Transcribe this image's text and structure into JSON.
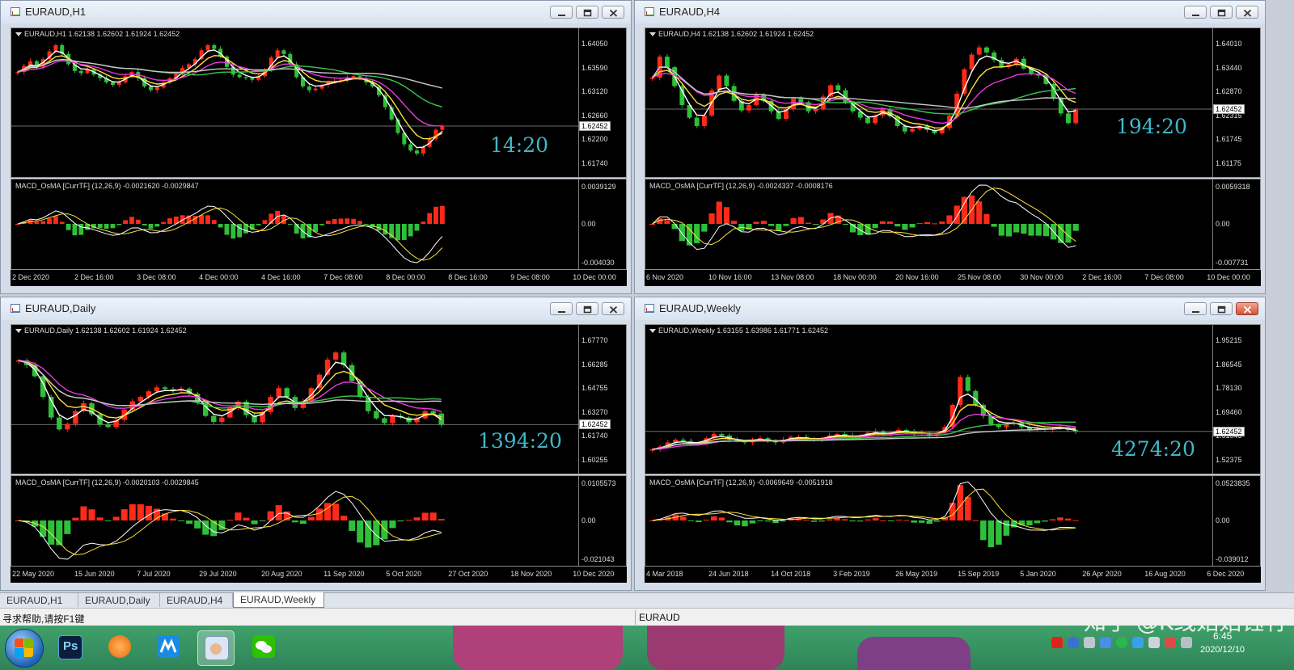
{
  "theme": {
    "bull": "#ff2a1a",
    "bear": "#2fc03a",
    "ma_white": "#ffffff",
    "ma_yellow": "#ffe23a",
    "ma_magenta": "#e53ae0",
    "ma_green": "#39c94a",
    "ma_gray": "#c8c8c8",
    "counter_color": "#3fb8c8"
  },
  "windows": [
    {
      "id": "h1",
      "title": "EURAUD,H1",
      "close_highlight": false,
      "legend": "EURAUD,H1  1.62138 1.62602 1.61924 1.62452",
      "price_ticks": [
        "1.64050",
        "1.63590",
        "1.63120",
        "1.62660",
        "1.62200",
        "1.61740"
      ],
      "current_price": "1.62452",
      "countdown": "14:20",
      "macd_legend": "MACD_OsMA [CurrTF] (12,26,9) -0.0021620 -0.0029847",
      "macd_ticks": [
        "0.0039129",
        "0.00",
        "-0.004030"
      ],
      "time_labels": [
        "2 Dec 2020",
        "2 Dec 16:00",
        "3 Dec 08:00",
        "4 Dec 00:00",
        "4 Dec 16:00",
        "7 Dec 08:00",
        "8 Dec 00:00",
        "8 Dec 16:00",
        "9 Dec 08:00",
        "10 Dec 00:00"
      ],
      "chart_data": {
        "type": "candlestick",
        "close": [
          1.635,
          1.6362,
          1.6371,
          1.636,
          1.6375,
          1.639,
          1.6402,
          1.6385,
          1.6365,
          1.6352,
          1.6348,
          1.6355,
          1.6345,
          1.6338,
          1.633,
          1.6325,
          1.633,
          1.6342,
          1.635,
          1.6338,
          1.6322,
          1.6315,
          1.632,
          1.633,
          1.6338,
          1.6346,
          1.6358,
          1.6365,
          1.6375,
          1.6392,
          1.6402,
          1.6395,
          1.638,
          1.636,
          1.6345,
          1.634,
          1.6338,
          1.6335,
          1.6342,
          1.6355,
          1.6378,
          1.6392,
          1.6385,
          1.6365,
          1.634,
          1.6322,
          1.6315,
          1.6318,
          1.6325,
          1.633,
          1.6332,
          1.6335,
          1.634,
          1.6342,
          1.6338,
          1.633,
          1.6322,
          1.6305,
          1.6282,
          1.6258,
          1.6232,
          1.621,
          1.6198,
          1.6192,
          1.6205,
          1.622,
          1.6238,
          1.6245
        ],
        "ma_overlays": [
          "white",
          "yellow",
          "magenta",
          "green",
          "gray"
        ],
        "current_price": 1.62452,
        "macd_histogram_range": [
          -0.00403,
          0.0039129
        ]
      }
    },
    {
      "id": "h4",
      "title": "EURAUD,H4",
      "close_highlight": false,
      "legend": "EURAUD,H4  1.62138 1.62602 1.61924 1.62452",
      "price_ticks": [
        "1.64010",
        "1.63440",
        "1.62870",
        "1.62315",
        "1.61745",
        "1.61175"
      ],
      "current_price": "1.62452",
      "countdown": "194:20",
      "macd_legend": "MACD_OsMA [CurrTF] (12,26,9) -0.0024337 -0.0008176",
      "macd_ticks": [
        "0.0059318",
        "0.00",
        "-0.007731"
      ],
      "time_labels": [
        "6 Nov 2020",
        "10 Nov 16:00",
        "13 Nov 08:00",
        "18 Nov 00:00",
        "20 Nov 16:00",
        "25 Nov 08:00",
        "30 Nov 00:00",
        "2 Dec 16:00",
        "7 Dec 08:00",
        "10 Dec 00:00"
      ],
      "chart_data": {
        "type": "candlestick",
        "close": [
          1.632,
          1.637,
          1.6345,
          1.63,
          1.6255,
          1.6225,
          1.6205,
          1.623,
          1.629,
          1.6325,
          1.63,
          1.6265,
          1.6242,
          1.6255,
          1.628,
          1.6265,
          1.624,
          1.6222,
          1.6246,
          1.627,
          1.6262,
          1.624,
          1.6245,
          1.6275,
          1.6302,
          1.629,
          1.626,
          1.624,
          1.6225,
          1.6212,
          1.623,
          1.6245,
          1.6228,
          1.6205,
          1.6192,
          1.6198,
          1.6205,
          1.6196,
          1.6188,
          1.62,
          1.623,
          1.6282,
          1.634,
          1.6375,
          1.6392,
          1.638,
          1.6362,
          1.6346,
          1.6352,
          1.6365,
          1.6342,
          1.633,
          1.6325,
          1.6305,
          1.627,
          1.6235,
          1.6212,
          1.6245
        ],
        "ma_overlays": [
          "white",
          "yellow",
          "magenta",
          "green",
          "gray"
        ],
        "current_price": 1.62452,
        "macd_histogram_range": [
          -0.007731,
          0.0059318
        ]
      }
    },
    {
      "id": "daily",
      "title": "EURAUD,Daily",
      "close_highlight": false,
      "legend": "EURAUD,Daily  1.62138 1.62602 1.61924 1.62452",
      "price_ticks": [
        "1.67770",
        "1.66285",
        "1.64755",
        "1.63270",
        "1.61740",
        "1.60255"
      ],
      "current_price": "1.62452",
      "countdown": "1394:20",
      "macd_legend": "MACD_OsMA [CurrTF] (12,26,9) -0.0020103 -0.0029845",
      "macd_ticks": [
        "0.0105573",
        "0.00",
        "-0.021043"
      ],
      "time_labels": [
        "22 May 2020",
        "15 Jun 2020",
        "7 Jul 2020",
        "29 Jul 2020",
        "20 Aug 2020",
        "11 Sep 2020",
        "5 Oct 2020",
        "27 Oct 2020",
        "18 Nov 2020",
        "10 Dec 2020"
      ],
      "chart_data": {
        "type": "candlestick",
        "close": [
          1.665,
          1.662,
          1.655,
          1.642,
          1.629,
          1.6215,
          1.625,
          1.633,
          1.638,
          1.631,
          1.6245,
          1.623,
          1.6275,
          1.634,
          1.6392,
          1.642,
          1.6455,
          1.648,
          1.647,
          1.6458,
          1.6472,
          1.644,
          1.6385,
          1.63,
          1.6262,
          1.629,
          1.635,
          1.639,
          1.6305,
          1.626,
          1.6325,
          1.642,
          1.6475,
          1.642,
          1.635,
          1.6392,
          1.6475,
          1.656,
          1.6655,
          1.67,
          1.662,
          1.652,
          1.642,
          1.633,
          1.6285,
          1.6255,
          1.63,
          1.629,
          1.626,
          1.6285,
          1.633,
          1.6315,
          1.6245
        ],
        "ma_overlays": [
          "white",
          "yellow",
          "magenta",
          "green",
          "gray"
        ],
        "current_price": 1.62452,
        "macd_histogram_range": [
          -0.021043,
          0.0105573
        ]
      }
    },
    {
      "id": "weekly",
      "title": "EURAUD,Weekly",
      "close_highlight": true,
      "legend": "EURAUD,Weekly  1.63155 1.63986 1.61771 1.62452",
      "price_ticks": [
        "1.95215",
        "1.86545",
        "1.78130",
        "1.69460",
        "1.61045",
        "1.52375"
      ],
      "current_price": "1.62452",
      "countdown": "4274:20",
      "macd_legend": "MACD_OsMA [CurrTF] (12,26,9) -0.0069649 -0.0051918",
      "macd_ticks": [
        "0.0523835",
        "0.00",
        "-0.039012"
      ],
      "time_labels": [
        "4 Mar 2018",
        "24 Jun 2018",
        "14 Oct 2018",
        "3 Feb 2019",
        "26 May 2019",
        "15 Sep 2019",
        "5 Jan 2020",
        "26 Apr 2020",
        "16 Aug 2020",
        "6 Dec 2020"
      ],
      "chart_data": {
        "type": "candlestick",
        "close": [
          1.56,
          1.57,
          1.585,
          1.595,
          1.59,
          1.58,
          1.585,
          1.6,
          1.615,
          1.61,
          1.595,
          1.59,
          1.585,
          1.595,
          1.6,
          1.59,
          1.585,
          1.595,
          1.605,
          1.605,
          1.6,
          1.595,
          1.6,
          1.61,
          1.615,
          1.61,
          1.605,
          1.61,
          1.62,
          1.625,
          1.615,
          1.62,
          1.63,
          1.625,
          1.615,
          1.62,
          1.61,
          1.62,
          1.64,
          1.72,
          1.82,
          1.77,
          1.72,
          1.68,
          1.65,
          1.64,
          1.65,
          1.655,
          1.64,
          1.63,
          1.635,
          1.63,
          1.635,
          1.64,
          1.63,
          1.6245
        ],
        "ma_overlays": [
          "white",
          "yellow",
          "magenta",
          "green",
          "gray"
        ],
        "current_price": 1.62452,
        "macd_histogram_range": [
          -0.039012,
          0.0523835
        ]
      }
    }
  ],
  "tabs": [
    "EURAUD,H1",
    "EURAUD,Daily",
    "EURAUD,H4",
    "EURAUD,Weekly"
  ],
  "active_tab": "EURAUD,Weekly",
  "status": {
    "help": "寻求帮助,请按F1键",
    "symbol": "EURAUD"
  },
  "taskbar": {
    "apps": [
      "start-orb",
      "photoshop",
      "app-orange",
      "app-blue-m",
      "remote-app",
      "wechat"
    ],
    "active_app": "remote-app",
    "time": "6:45",
    "date": "2020/12/10",
    "watermark": "知乎 @K线姑姑钰竹"
  }
}
